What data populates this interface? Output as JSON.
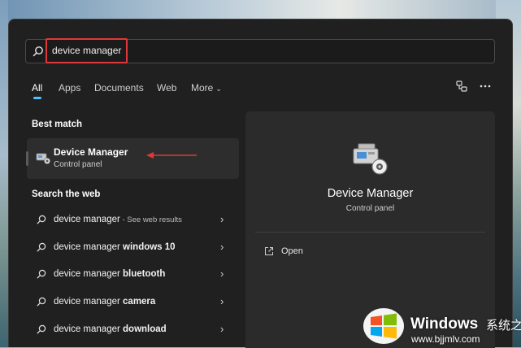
{
  "search": {
    "query": "device manager"
  },
  "tabs": [
    {
      "label": "All"
    },
    {
      "label": "Apps"
    },
    {
      "label": "Documents"
    },
    {
      "label": "Web"
    },
    {
      "label": "More"
    }
  ],
  "best_match": {
    "heading": "Best match",
    "title": "Device Manager",
    "subtitle": "Control panel"
  },
  "web": {
    "heading": "Search the web",
    "items": [
      {
        "prefix": "device manager",
        "bold": "",
        "suffix": " - See web results"
      },
      {
        "prefix": "device manager",
        "bold": " windows 10",
        "suffix": ""
      },
      {
        "prefix": "device manager",
        "bold": " bluetooth",
        "suffix": ""
      },
      {
        "prefix": "device manager",
        "bold": " camera",
        "suffix": ""
      },
      {
        "prefix": "device manager",
        "bold": " download",
        "suffix": ""
      }
    ]
  },
  "preview": {
    "title": "Device Manager",
    "subtitle": "Control panel",
    "action": "Open"
  },
  "watermark": {
    "brand": "Windows",
    "brand_cn": "系统之家",
    "url": "www.bjjmlv.com"
  },
  "colors": {
    "accent": "#4cc2ff",
    "highlight": "#e0383a",
    "panel": "#202020"
  }
}
